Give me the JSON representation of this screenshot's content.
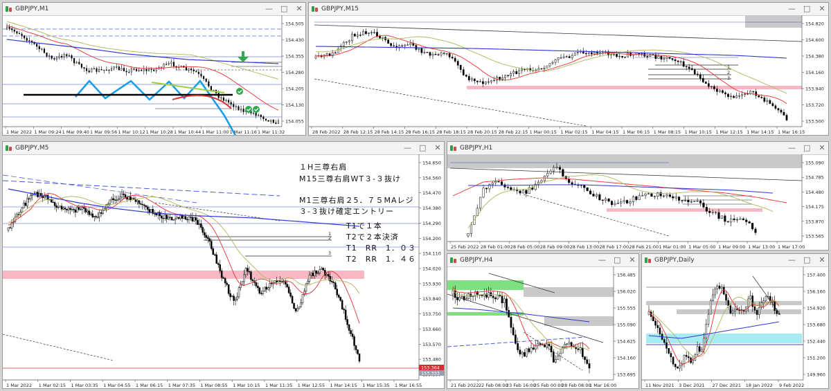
{
  "controls": {
    "minimize": "—",
    "restore": "□",
    "close": "✕"
  },
  "colors": {
    "bull": "#ffffff",
    "bear": "#000000",
    "ma_red": "#e8302c",
    "ma_olive": "#b3b35a",
    "ma_blue": "#2b37d6",
    "zone_pink": "#f7b8c4",
    "zone_gray": "#c9c9c9",
    "zone_green": "#7fe07f",
    "zone_cyan": "#a6ecf2",
    "current_price": "#d23030"
  },
  "windows": {
    "m1": {
      "title": "GBPJPY,M1",
      "yticks": [
        "154.505",
        "154.430",
        "154.355",
        "154.280",
        "154.205",
        "154.130",
        "154.055"
      ],
      "xticks": [
        "1 Mar 2022",
        "1 Mar 09:24",
        "1 Mar 09:40",
        "1 Mar 09:56",
        "1 Mar 10:12",
        "1 Mar 10:28",
        "1 Mar 10:44",
        "1 Mar 11:00",
        "1 Mar 11:16",
        "1 Mar 11:32"
      ]
    },
    "m15": {
      "title": "GBPJPY,M15",
      "yticks": [
        "154.820",
        "154.600",
        "154.380",
        "154.160",
        "153.940",
        "153.720",
        "153.500"
      ],
      "xticks": [
        "28 Feb 2022",
        "28 Feb 12:15",
        "28 Feb 14:15",
        "28 Feb 16:15",
        "28 Feb 18:15",
        "28 Feb 20:15",
        "28 Feb 22:15",
        "1 Mar 00:15",
        "1 Mar 02:15",
        "1 Mar 04:15",
        "1 Mar 06:15",
        "1 Mar 08:15",
        "1 Mar 10:15",
        "1 Mar 12:15",
        "1 Mar 14:15",
        "1 Mar 16:15"
      ],
      "levels": [
        "1",
        "2",
        "3"
      ]
    },
    "m5": {
      "title": "GBPJPY,M5",
      "yticks": [
        "154.650",
        "154.560",
        "154.470",
        "154.380",
        "154.290",
        "154.200",
        "154.110",
        "154.020",
        "153.930",
        "153.840",
        "153.750",
        "153.660",
        "153.570",
        "153.480",
        "153.390"
      ],
      "xticks": [
        "1 Mar 2022",
        "1 Mar 02:15",
        "1 Mar 03:35",
        "1 Mar 04:55",
        "1 Mar 06:15",
        "1 Mar 07:35",
        "1 Mar 08:55",
        "1 Mar 10:15",
        "1 Mar 11:35",
        "1 Mar 12:55",
        "1 Mar 14:15",
        "1 Mar 15:35",
        "1 Mar 16:55"
      ],
      "price_tag": "153.364",
      "price_tag2": "153.333",
      "levels": [
        "1",
        "2",
        "3"
      ],
      "notes": [
        "１H三尊右肩",
        "M15三尊右肩WT３-３抜け",
        "M1三尊右肩２5．７５MAレジ",
        "３-３抜け確定エントリー",
        "T1で１本",
        "T2で２本決済",
        "T1　RR　1．０３",
        "T2　RR　1．４６"
      ]
    },
    "h1": {
      "title": "GBPJPY,H1",
      "yticks": [
        "155.090",
        "154.785",
        "154.480",
        "154.175",
        "153.870",
        "153.565"
      ],
      "xticks": [
        "25 Feb 2022",
        "28 Feb 01:00",
        "28 Feb 05:00",
        "28 Feb 09:00",
        "28 Feb 13:00",
        "28 Feb 17:00",
        "28 Feb 21:00",
        "1 Mar 01:00",
        "1 Mar 05:00",
        "1 Mar 09:00",
        "1 Mar 13:00",
        "1 Mar 17:00"
      ]
    },
    "h4": {
      "title": "GBPJPY,H4",
      "yticks": [
        "156.485",
        "156.020",
        "155.555",
        "155.090",
        "154.625",
        "154.160",
        "153.695"
      ],
      "xticks": [
        "21 Feb 2022",
        "22 Feb 08:00",
        "23 Feb 16:00",
        "25 Feb 00:00",
        "28 Feb 08:00",
        "1 Mar 16:00"
      ]
    },
    "daily": {
      "title": "GBPJPY,Daily",
      "yticks": [
        "157.400",
        "156.160",
        "154.920",
        "153.680",
        "152.440",
        "151.200",
        "149.960"
      ],
      "xticks": [
        "11 Nov 2021",
        "3 Dec 2021",
        "27 Dec 2021",
        "18 Jan 2022",
        "9 Feb 2022"
      ]
    }
  }
}
